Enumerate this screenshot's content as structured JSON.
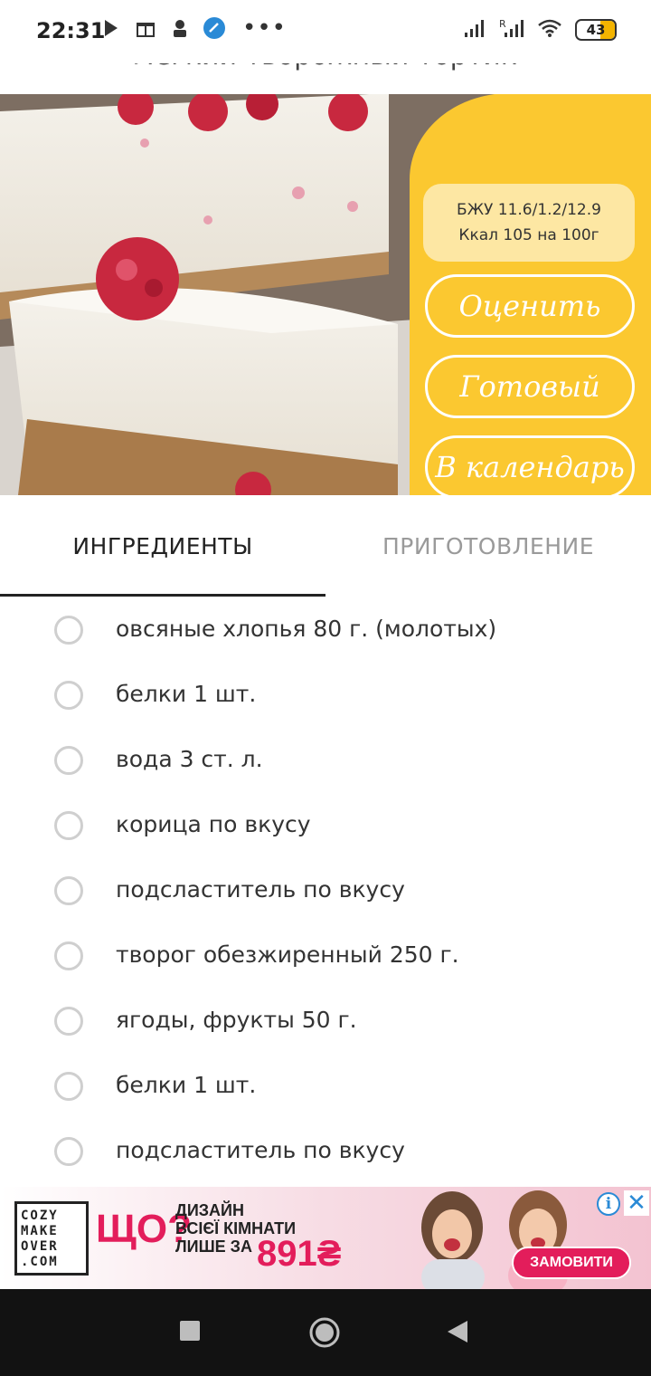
{
  "status_bar": {
    "time": "22:31",
    "dots": "•••",
    "battery": "43",
    "icons": [
      "play-store-icon",
      "gift-icon",
      "game-icon",
      "browser-icon",
      "signal-icon",
      "signal-roaming-icon",
      "wifi-icon",
      "battery-icon"
    ]
  },
  "recipe": {
    "title": "Легкий творожный тортик"
  },
  "hero": {
    "nutrition_line1": "БЖУ 11.6/1.2/12.9",
    "nutrition_line2": "Ккал 105 на 100г",
    "rate_button": "Оценить",
    "ready_button": "Готовый",
    "calendar_button": "В календарь",
    "accent_color": "#fbc830"
  },
  "tabs": {
    "ingredients": "ИНГРЕДИЕНТЫ",
    "preparation": "ПРИГОТОВЛЕНИЕ",
    "active": "ingredients"
  },
  "ingredients": [
    "овсяные хлопья 80 г. (молотых)",
    "белки 1 шт.",
    "вода 3 ст. л.",
    "корица по вкусу",
    "подсластитель по вкусу",
    "творог обезжиренный 250 г.",
    "ягоды, фрукты 50 г.",
    "белки 1 шт.",
    "подсластитель по вкусу"
  ],
  "ad": {
    "logo_line1": "COZY",
    "logo_line2": "MAKE",
    "logo_line3": "OVER",
    "logo_line4": ".COM",
    "headline": "ЩО?",
    "text_line1": "ДИЗАЙН",
    "text_line2": "ВСІЄЇ КІМНАТИ",
    "text_line3": "ЛИШЕ ЗА",
    "price": "891₴",
    "cta": "ЗАМОВИТИ",
    "brand_color": "#e31d5b"
  }
}
